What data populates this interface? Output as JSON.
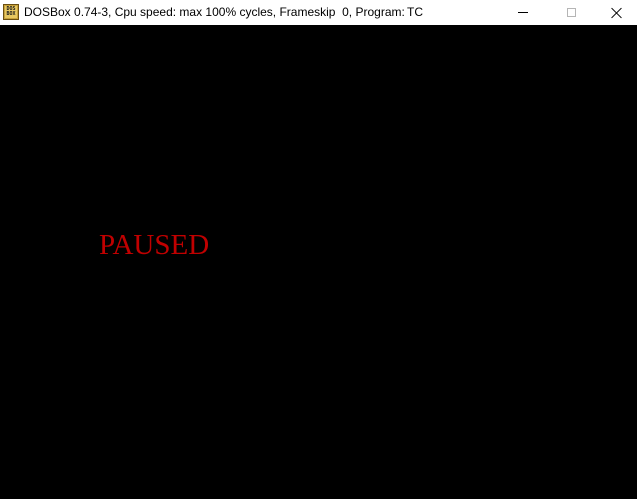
{
  "window": {
    "title": "DOSBox 0.74-3, Cpu speed: max 100% cycles, Frameskip  0, Program:",
    "program": "TC",
    "icon": "dosbox-icon",
    "icon_text_top": "DOS",
    "icon_text_bottom": "BOX"
  },
  "controls": {
    "minimize_icon": "minimize-icon",
    "maximize_icon": "maximize-icon",
    "close_icon": "close-icon"
  },
  "screen": {
    "status_text": "PAUSED",
    "status_color": "#c00000",
    "background": "#000000"
  }
}
